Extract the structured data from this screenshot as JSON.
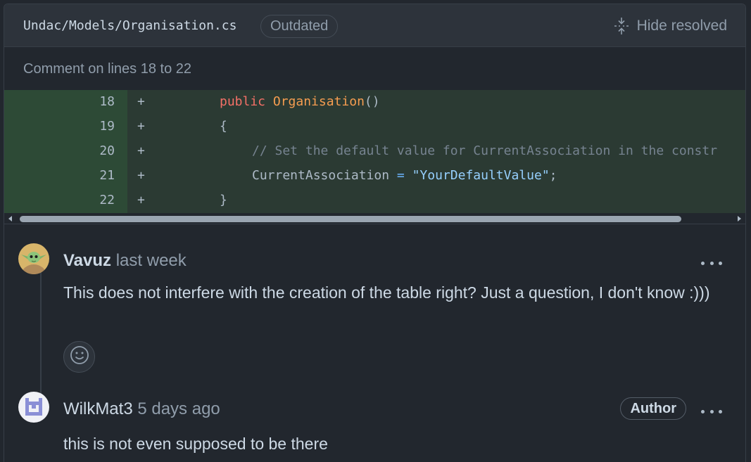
{
  "file": {
    "path": "Undac/Models/Organisation.cs",
    "status_badge": "Outdated",
    "hide_resolved_label": "Hide resolved"
  },
  "comment_range": "Comment on lines 18 to 22",
  "diff_lines": [
    {
      "num": "18",
      "sign": "+"
    },
    {
      "num": "19",
      "sign": "+"
    },
    {
      "num": "20",
      "sign": "+"
    },
    {
      "num": "21",
      "sign": "+"
    },
    {
      "num": "22",
      "sign": "+"
    }
  ],
  "code": {
    "l18_kw": "public",
    "l18_fn": "Organisation",
    "l18_rest": "()",
    "l19": "{",
    "l20_comment": "// Set the default value for CurrentAssociation in the constr",
    "l21_ident": "CurrentAssociation ",
    "l21_op": "=",
    "l21_str": "\"YourDefaultValue\"",
    "l21_end": ";",
    "l22": "}"
  },
  "comments": [
    {
      "author": "Vavuz",
      "time": "last week",
      "body": "This does not interfere with the creation of the table right? Just a question, I don't know :)))"
    },
    {
      "author": "WilkMat3",
      "time": "5 days ago",
      "badge": "Author",
      "body": "this is not even supposed to be there"
    }
  ],
  "colors": {
    "background": "#22272e",
    "added_line": "#2b3a33",
    "added_gutter": "#2d4a36",
    "keyword": "#f47067",
    "function": "#f69d50",
    "string": "#96d0ff"
  },
  "icons": {
    "hide_resolved": "unfold-icon",
    "reaction": "smiley-icon",
    "menu": "kebab-horizontal-icon"
  }
}
